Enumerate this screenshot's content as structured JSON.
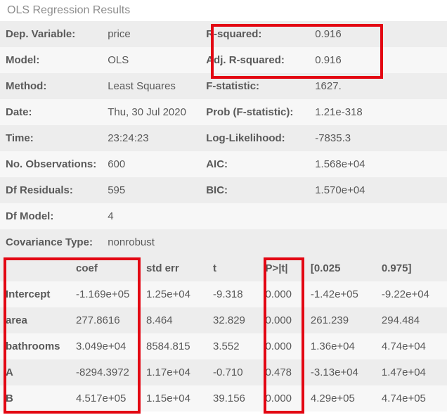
{
  "title": "OLS Regression Results",
  "summary": {
    "rows": [
      {
        "l1": "Dep. Variable:",
        "v1": "price",
        "l2": "R-squared:",
        "v2": "0.916"
      },
      {
        "l1": "Model:",
        "v1": "OLS",
        "l2": "Adj. R-squared:",
        "v2": "0.916"
      },
      {
        "l1": "Method:",
        "v1": "Least Squares",
        "l2": "F-statistic:",
        "v2": "1627."
      },
      {
        "l1": "Date:",
        "v1": "Thu, 30 Jul 2020",
        "l2": "Prob (F-statistic):",
        "v2": "1.21e-318"
      },
      {
        "l1": "Time:",
        "v1": "23:24:23",
        "l2": "Log-Likelihood:",
        "v2": "-7835.3"
      },
      {
        "l1": "No. Observations:",
        "v1": "600",
        "l2": "AIC:",
        "v2": "1.568e+04"
      },
      {
        "l1": "Df Residuals:",
        "v1": "595",
        "l2": "BIC:",
        "v2": "1.570e+04"
      },
      {
        "l1": "Df Model:",
        "v1": "4",
        "l2": "",
        "v2": ""
      },
      {
        "l1": "Covariance Type:",
        "v1": "nonrobust",
        "l2": "",
        "v2": ""
      }
    ]
  },
  "coef": {
    "headers": [
      "",
      "coef",
      "std err",
      "t",
      "P>|t|",
      "[0.025",
      "0.975]"
    ],
    "rows": [
      {
        "name": "Intercept",
        "coef": "-1.169e+05",
        "stderr": "1.25e+04",
        "t": "-9.318",
        "p": "0.000",
        "lo": "-1.42e+05",
        "hi": "-9.22e+04"
      },
      {
        "name": "area",
        "coef": "277.8616",
        "stderr": "8.464",
        "t": "32.829",
        "p": "0.000",
        "lo": "261.239",
        "hi": "294.484"
      },
      {
        "name": "bathrooms",
        "coef": "3.049e+04",
        "stderr": "8584.815",
        "t": "3.552",
        "p": "0.000",
        "lo": "1.36e+04",
        "hi": "4.74e+04"
      },
      {
        "name": "A",
        "coef": "-8294.3972",
        "stderr": "1.17e+04",
        "t": "-0.710",
        "p": "0.478",
        "lo": "-3.13e+04",
        "hi": "1.47e+04"
      },
      {
        "name": "B",
        "coef": "4.517e+05",
        "stderr": "1.15e+04",
        "t": "39.156",
        "p": "0.000",
        "lo": "4.29e+05",
        "hi": "4.74e+05"
      }
    ]
  }
}
